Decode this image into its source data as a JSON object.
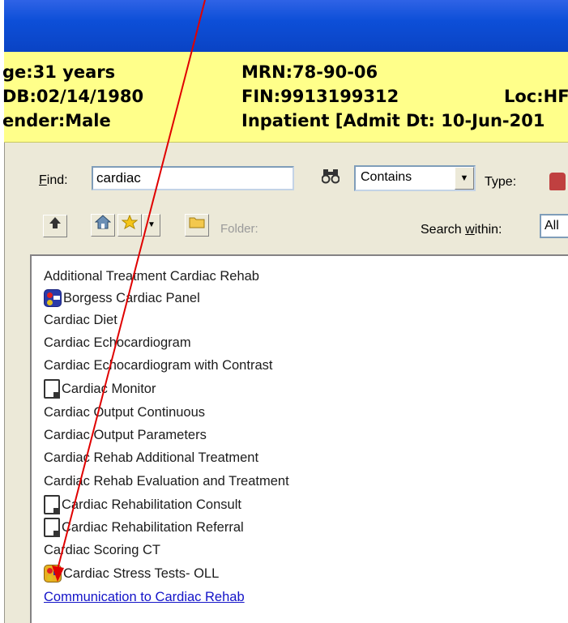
{
  "banner": {
    "age": "ge:31 years",
    "dob": "DB:02/14/1980",
    "gender": "ender:Male",
    "mrn": "MRN:78-90-06",
    "fin": "FIN:9913199312",
    "loc": "Loc:HF",
    "encounter": "Inpatient [Admit Dt: 10-Jun-201"
  },
  "search": {
    "find_label_key": "F",
    "find_label_rest": "ind:",
    "find_value": "cardiac",
    "match_mode": "Contains",
    "type_label": "Type:",
    "folder_label": "Folder:",
    "search_within_label_a": "Search ",
    "search_within_label_key": "w",
    "search_within_label_b": "ithin:",
    "search_within_value": "All"
  },
  "toolbar": {
    "up_icon": "up-arrow-icon",
    "home_icon": "home-icon",
    "favorites_icon": "star-icon",
    "folder_icon": "folder-icon"
  },
  "results": [
    {
      "label": "Additional Treatment Cardiac Rehab",
      "icon": "none"
    },
    {
      "label": "Borgess Cardiac Panel",
      "icon": "powerplan-icon"
    },
    {
      "label": "Cardiac Diet",
      "icon": "none"
    },
    {
      "label": "Cardiac Echocardiogram",
      "icon": "none"
    },
    {
      "label": "Cardiac Echocardiogram with Contrast",
      "icon": "none"
    },
    {
      "label": "Cardiac Monitor",
      "icon": "document-icon"
    },
    {
      "label": "Cardiac Output Continuous",
      "icon": "none"
    },
    {
      "label": "Cardiac Output Parameters",
      "icon": "none"
    },
    {
      "label": "Cardiac Rehab Additional Treatment",
      "icon": "none"
    },
    {
      "label": "Cardiac Rehab Evaluation and Treatment",
      "icon": "none"
    },
    {
      "label": "Cardiac Rehabilitation Consult",
      "icon": "document-icon"
    },
    {
      "label": "Cardiac Rehabilitation Referral",
      "icon": "document-icon"
    },
    {
      "label": "Cardiac Scoring CT",
      "icon": "none"
    },
    {
      "label": "Cardiac Stress Tests- OLL",
      "icon": "powerplan-icon"
    },
    {
      "label": "Communication to Cardiac Rehab",
      "icon": "none"
    }
  ],
  "colors": {
    "titlebar": "#0d4fd8",
    "banner": "#ffff8a",
    "arrow": "#e00000",
    "link": "#1313c8"
  }
}
